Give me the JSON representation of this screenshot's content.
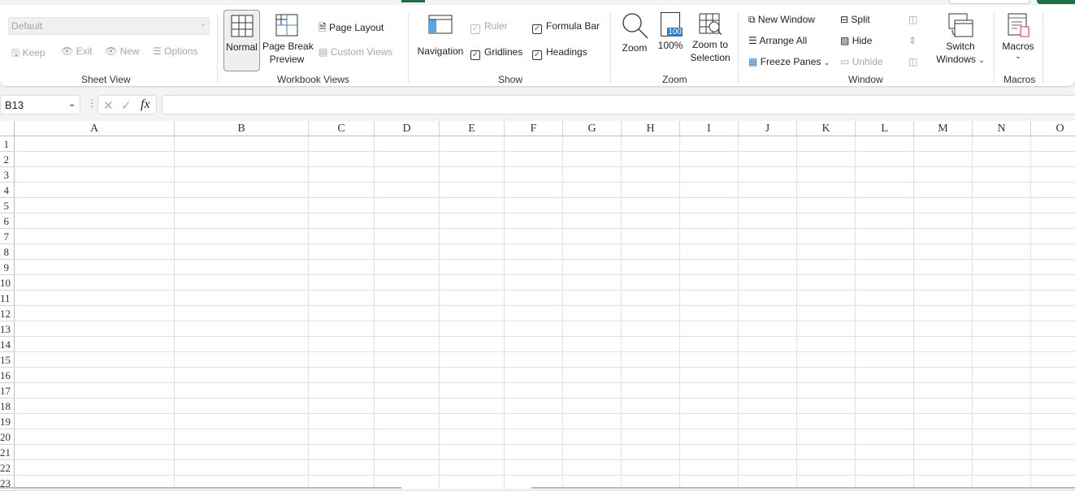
{
  "ribbon": {
    "sheet_view": {
      "select_value": "Default",
      "keep": "Keep",
      "exit": "Exit",
      "new": "New",
      "options": "Options",
      "group": "Sheet View"
    },
    "workbook_views": {
      "normal": "Normal",
      "page_break_1": "Page Break",
      "page_break_2": "Preview",
      "page_layout": "Page Layout",
      "custom_views": "Custom Views",
      "group": "Workbook Views"
    },
    "show": {
      "navigation": "Navigation",
      "ruler": "Ruler",
      "formula_bar": "Formula Bar",
      "gridlines": "Gridlines",
      "headings": "Headings",
      "group": "Show",
      "ruler_checked": true,
      "formula_bar_checked": true,
      "gridlines_checked": true,
      "headings_checked": true
    },
    "zoom": {
      "zoom": "Zoom",
      "hundred": "100%",
      "hundred_icon": "100",
      "zoom_sel_1": "Zoom to",
      "zoom_sel_2": "Selection",
      "group": "Zoom"
    },
    "window": {
      "new_window": "New Window",
      "arrange_all": "Arrange All",
      "freeze_panes": "Freeze Panes",
      "split": "Split",
      "hide": "Hide",
      "unhide": "Unhide",
      "switch_1": "Switch",
      "switch_2": "Windows",
      "group": "Window"
    },
    "macros": {
      "macros": "Macros",
      "group": "Macros"
    }
  },
  "formula_bar": {
    "name_box": "B13",
    "formula": ""
  },
  "sheet": {
    "columns": [
      "A",
      "B",
      "C",
      "D",
      "E",
      "F",
      "G",
      "H",
      "I",
      "J",
      "K",
      "L",
      "M",
      "N",
      "O"
    ],
    "rows": [
      "1",
      "2",
      "3",
      "4",
      "5",
      "6",
      "7",
      "8",
      "9",
      "10",
      "11",
      "12",
      "13",
      "14",
      "15",
      "16",
      "17",
      "18",
      "19",
      "20",
      "21",
      "22",
      "23"
    ]
  },
  "colors": {
    "accent": "#1e7145"
  }
}
